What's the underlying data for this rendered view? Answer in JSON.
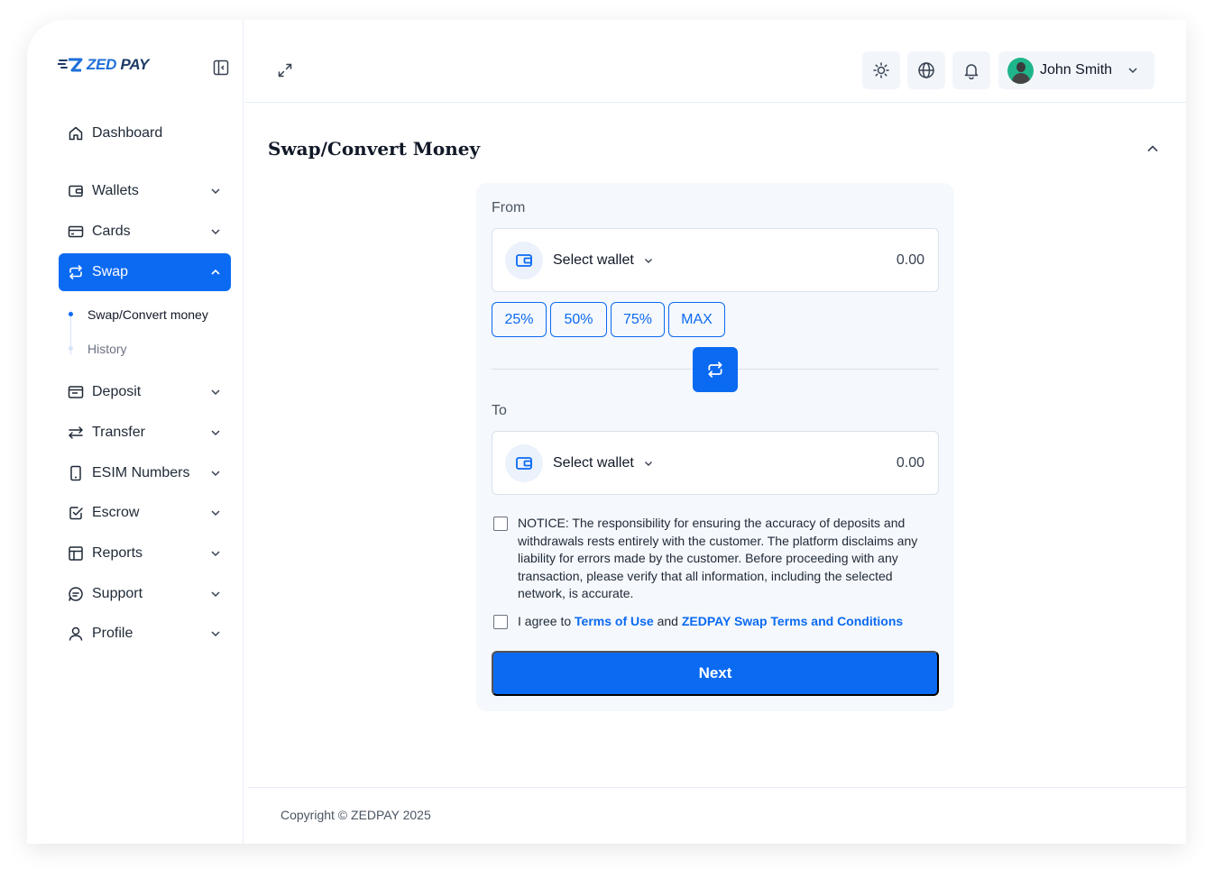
{
  "brand": {
    "logo_part1": "ZED",
    "logo_part2": "PAY"
  },
  "sidebar": {
    "items": [
      {
        "label": "Dashboard",
        "icon": "home-icon"
      },
      {
        "label": "Wallets",
        "icon": "wallet-icon"
      },
      {
        "label": "Cards",
        "icon": "card-icon"
      },
      {
        "label": "Swap",
        "icon": "swap-icon"
      },
      {
        "label": "Deposit",
        "icon": "deposit-icon"
      },
      {
        "label": "Transfer",
        "icon": "transfer-icon"
      },
      {
        "label": "ESIM Numbers",
        "icon": "sim-icon"
      },
      {
        "label": "Escrow",
        "icon": "escrow-icon"
      },
      {
        "label": "Reports",
        "icon": "reports-icon"
      },
      {
        "label": "Support",
        "icon": "support-icon"
      },
      {
        "label": "Profile",
        "icon": "profile-icon"
      }
    ],
    "active": "Swap",
    "swap_submenu": [
      {
        "label": "Swap/Convert money",
        "active": true
      },
      {
        "label": "History",
        "active": false
      }
    ]
  },
  "header": {
    "user_name": "John Smith",
    "icons": [
      "sun-icon",
      "globe-icon",
      "bell-icon"
    ]
  },
  "page": {
    "title": "Swap/Convert Money"
  },
  "swap_form": {
    "from_label": "From",
    "to_label": "To",
    "from_wallet": {
      "placeholder": "Select wallet",
      "amount": "0.00"
    },
    "to_wallet": {
      "placeholder": "Select wallet",
      "amount": "0.00"
    },
    "percent_buttons": [
      "25%",
      "50%",
      "75%",
      "MAX"
    ],
    "notice_text": "NOTICE: The responsibility for ensuring the accuracy of deposits and withdrawals rests entirely with the customer. The platform disclaims any liability for errors made by the customer. Before proceeding with any transaction, please verify that all information, including the selected network, is accurate.",
    "agree_prefix": "I agree to",
    "agree_link1": "Terms of Use",
    "agree_and": "and",
    "agree_link2": "ZEDPAY Swap Terms and Conditions",
    "next_label": "Next"
  },
  "footer": {
    "copyright": "Copyright © ZEDPAY 2025"
  },
  "colors": {
    "accent": "#0b6af2",
    "panel": "#f5f8fc",
    "text": "#1f2937"
  }
}
